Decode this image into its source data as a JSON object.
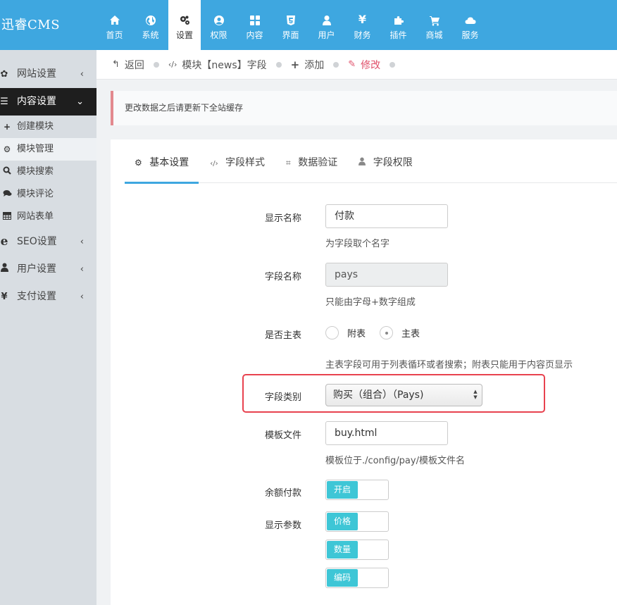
{
  "brand": "迅睿CMS",
  "topnav": [
    {
      "label": "首页",
      "icon": "home-icon"
    },
    {
      "label": "系统",
      "icon": "globe-icon"
    },
    {
      "label": "设置",
      "icon": "gears-icon"
    },
    {
      "label": "权限",
      "icon": "user-circle-icon"
    },
    {
      "label": "内容",
      "icon": "grid-icon"
    },
    {
      "label": "界面",
      "icon": "html5-icon"
    },
    {
      "label": "用户",
      "icon": "user-icon"
    },
    {
      "label": "财务",
      "icon": "yen-icon"
    },
    {
      "label": "插件",
      "icon": "puzzle-icon"
    },
    {
      "label": "商城",
      "icon": "cart-icon"
    },
    {
      "label": "服务",
      "icon": "cloud-icon"
    }
  ],
  "topnav_active": "设置",
  "sidebar": {
    "items": [
      {
        "label": "网站设置",
        "icon": "gear-icon"
      },
      {
        "label": "内容设置",
        "icon": "list-icon"
      }
    ],
    "sub_items": [
      {
        "label": "创建模块",
        "icon": "plus-icon"
      },
      {
        "label": "模块管理",
        "icon": "gears-icon"
      },
      {
        "label": "模块搜索",
        "icon": "search-icon"
      },
      {
        "label": "模块评论",
        "icon": "comments-icon"
      },
      {
        "label": "网站表单",
        "icon": "table-icon"
      }
    ],
    "items2": [
      {
        "label": "SEO设置",
        "icon": "ie-icon"
      },
      {
        "label": "用户设置",
        "icon": "user-icon"
      },
      {
        "label": "支付设置",
        "icon": "yen-icon"
      }
    ]
  },
  "breadcrumb": {
    "back": "返回",
    "module_field": "模块【news】字段",
    "add": "添加",
    "edit": "修改"
  },
  "alert": "更改数据之后请更新下全站缓存",
  "tabs": [
    {
      "label": "基本设置",
      "icon": "gear-icon"
    },
    {
      "label": "字段样式",
      "icon": "code-icon"
    },
    {
      "label": "数据验证",
      "icon": "crop-icon"
    },
    {
      "label": "字段权限",
      "icon": "user-icon"
    }
  ],
  "form": {
    "display_name_label": "显示名称",
    "display_name_value": "付款",
    "display_name_help": "为字段取个名字",
    "field_name_label": "字段名称",
    "field_name_value": "pays",
    "field_name_help": "只能由字母+数字组成",
    "is_main_label": "是否主表",
    "radio_sub": "附表",
    "radio_main": "主表",
    "radio_selected": "主表",
    "is_main_help": "主表字段可用于列表循环或者搜索；附表只能用于内容页显示",
    "field_type_label": "字段类别",
    "field_type_value": "购买（组合）（Pays)",
    "template_label": "模板文件",
    "template_value": "buy.html",
    "template_help": "模板位于./config/pay/模板文件名",
    "balance_label": "余额付款",
    "balance_toggle": "开启",
    "params_label": "显示参数",
    "params": [
      "价格",
      "数量",
      "编码"
    ]
  }
}
